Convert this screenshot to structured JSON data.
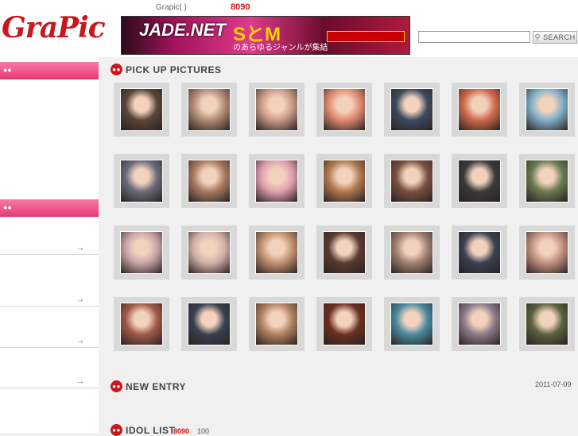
{
  "header": {
    "logo_text": "GraPic",
    "site_count_label": "Grapic(   )",
    "site_count_value": "8090",
    "banner": {
      "line1": "JADE.NET",
      "line2": "SとM",
      "line3": "のあらゆるジャンルが集結"
    }
  },
  "search": {
    "placeholder": "",
    "button_label": "SEARCH"
  },
  "sidebar": {
    "sections": [
      {
        "icon": "user-icon"
      },
      {
        "icon": "user-icon"
      }
    ],
    "items": [
      {
        "arrow": "→"
      },
      {
        "arrow": "→"
      },
      {
        "arrow": "→"
      },
      {
        "arrow": "→"
      }
    ]
  },
  "sections": {
    "pickup_title": "PICK UP PICTURES",
    "new_entry_title": "NEW ENTRY",
    "new_entry_date": "2011-07-09",
    "idol_list_title": "IDOL LIST",
    "idol_list_count": "8090",
    "idol_list_total": "100"
  },
  "pictures": {
    "colors": [
      [
        "#5a4438",
        "#b08a74",
        "#c79a86",
        "#e08a70",
        "#3c4a60",
        "#d06a4a",
        "#80b0c8"
      ],
      [
        "#6a6a7a",
        "#a87a60",
        "#e0a0b0",
        "#b07850",
        "#7a5040",
        "#3a3a3a",
        "#6a7a50"
      ],
      [
        "#c8a4a8",
        "#d0b0a8",
        "#c09070",
        "#5a3a30",
        "#a08070",
        "#3a4050",
        "#c09080"
      ],
      [
        "#a05a48",
        "#3a4050",
        "#b08060",
        "#6a3020",
        "#4a8aa0",
        "#8a7a88",
        "#5a6040"
      ]
    ]
  }
}
